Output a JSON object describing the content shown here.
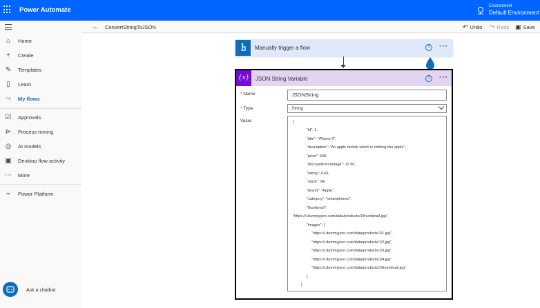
{
  "app": {
    "title": "Power Automate"
  },
  "environment": {
    "label": "Environment",
    "value": "Default Environment"
  },
  "sidebar": {
    "items": [
      {
        "label": "Home",
        "icon": "home-icon"
      },
      {
        "label": "Create",
        "icon": "plus-icon"
      },
      {
        "label": "Templates",
        "icon": "templates-icon"
      },
      {
        "label": "Learn",
        "icon": "book-icon"
      },
      {
        "label": "My flows",
        "icon": "flows-icon"
      },
      {
        "label": "Approvals",
        "icon": "approvals-icon"
      },
      {
        "label": "Process mining",
        "icon": "process-mining-icon"
      },
      {
        "label": "AI models",
        "icon": "ai-models-icon"
      },
      {
        "label": "Desktop flow activity",
        "icon": "desktop-flow-icon"
      },
      {
        "label": "More",
        "icon": "more-icon"
      },
      {
        "label": "Power Platform",
        "icon": "power-platform-icon"
      }
    ],
    "active": "My flows",
    "chatbot_label": "Ask a chatbot"
  },
  "command_bar": {
    "flow_name": "ConvertStringToJSON",
    "undo_label": "Undo",
    "redo_label": "Redo",
    "save_label": "Save"
  },
  "trigger": {
    "title": "Manually trigger a flow"
  },
  "action": {
    "title": "JSON String Variable",
    "icon_text": "{x}",
    "name_label": "Name",
    "name_value": "JSONString",
    "type_label": "Type",
    "type_value": "String",
    "value_label": "Value",
    "value_lines": [
      "{",
      "\"id\": 1,",
      "\"title\": \"iPhone 9\",",
      "\"description\": \"An apple mobile which is nothing like apple\",",
      "\"price\": 549,",
      "\"discountPercentage\": 12.96,",
      "\"rating\": 4.69,",
      "\"stock\": 94,",
      "\"brand\": \"Apple\",",
      "\"category\": \"smartphones\",",
      "\"thumbnail\":",
      "\"https://i.dummyjson.com/data/products/1/thumbnail.jpg\",",
      "\"images\": [",
      "\"https://i.dummyjson.com/data/products/1/1.jpg\",",
      "\"https://i.dummyjson.com/data/products/1/2.jpg\",",
      "\"https://i.dummyjson.com/data/products/1/3.jpg\",",
      "\"https://i.dummyjson.com/data/products/1/4.jpg\",",
      "\"https://i.dummyjson.com/data/products/1/thumbnail.jpg\"",
      "]",
      "}"
    ]
  },
  "colors": {
    "topbar": "#0066ff",
    "accent": "#0f6cbd",
    "variable_icon": "#770bd6",
    "variable_header": "#e3d4f0",
    "trigger_header": "#dfe9fa"
  }
}
